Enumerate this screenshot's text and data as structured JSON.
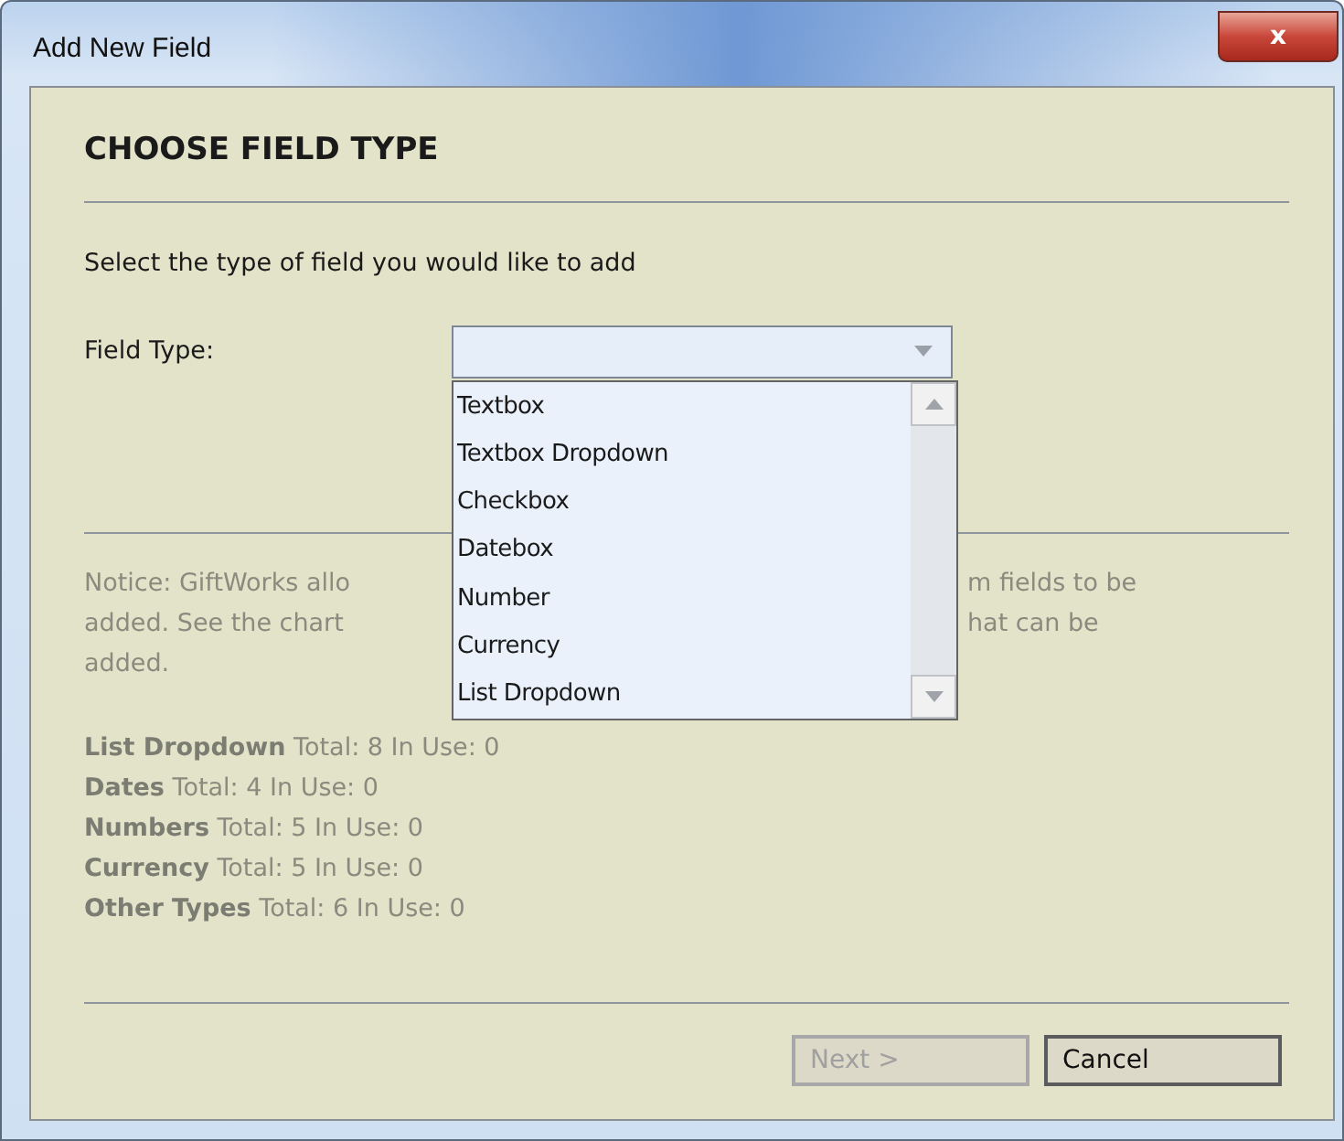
{
  "window": {
    "title": "Add New Field",
    "close": "x"
  },
  "heading": "CHOOSE FIELD TYPE",
  "instruction": "Select the type of field you would like to add",
  "field_type": {
    "label": "Field Type:",
    "expanded": true,
    "options": [
      "Textbox",
      "Textbox Dropdown",
      "Checkbox",
      "Datebox",
      "Number",
      "Currency",
      "List Dropdown"
    ]
  },
  "notice_lines": [
    {
      "left": "Notice: GiftWorks allo",
      "right": "m fields to be"
    },
    {
      "left": "added. See the chart",
      "right": "hat can be"
    },
    {
      "left": "added."
    }
  ],
  "stats": [
    "**List Dropdown** Total: 8 In Use: 0",
    "**Dates** Total: 4 In Use: 0",
    "**Numbers** Total: 5 In Use: 0",
    "**Currency** Total: 5 In Use: 0",
    "**Other Types** Total: 6 In Use: 0"
  ],
  "buttons": [
    {
      "label": "Next >",
      "disabled": true
    },
    {
      "label": "Cancel",
      "disabled": false
    }
  ]
}
